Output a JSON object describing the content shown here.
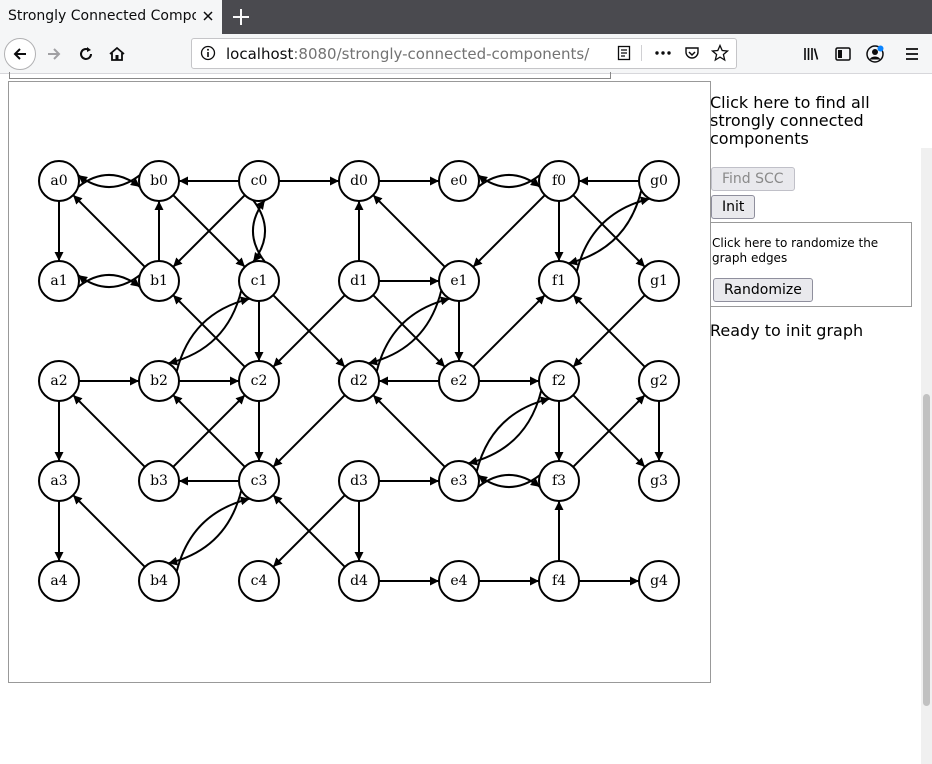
{
  "browser": {
    "tab_title": "Strongly Connected Components",
    "url_host": "localhost",
    "url_path": ":8080/strongly-connected-components/",
    "icons": [
      "back-arrow-icon",
      "forward-arrow-icon",
      "reload-icon",
      "home-icon",
      "info-icon",
      "reader-view-icon",
      "more-icon",
      "pocket-icon",
      "bookmark-star-icon",
      "library-icon",
      "sidebar-icon",
      "account-icon",
      "menu-icon"
    ]
  },
  "panel": {
    "find_description": "Click here to find all strongly connected components",
    "find_button": "Find SCC",
    "init_button": "Init",
    "randomize_description": "Click here to randomize the graph edges",
    "randomize_button": "Randomize",
    "status": "Ready to init graph"
  },
  "graph": {
    "nodes": [
      "a0",
      "b0",
      "c0",
      "d0",
      "e0",
      "f0",
      "g0",
      "a1",
      "b1",
      "c1",
      "d1",
      "e1",
      "f1",
      "g1",
      "a2",
      "b2",
      "c2",
      "d2",
      "e2",
      "f2",
      "g2",
      "a3",
      "b3",
      "c3",
      "d3",
      "e3",
      "f3",
      "g3",
      "a4",
      "b4",
      "c4",
      "d4",
      "e4",
      "f4",
      "g4"
    ],
    "edges": [
      [
        "a0",
        "a1"
      ],
      [
        "a0",
        "b0"
      ],
      [
        "b0",
        "a0"
      ],
      [
        "a1",
        "b1"
      ],
      [
        "b1",
        "a1"
      ],
      [
        "b1",
        "a0"
      ],
      [
        "b1",
        "b0"
      ],
      [
        "b0",
        "c1"
      ],
      [
        "c0",
        "b0"
      ],
      [
        "c0",
        "b1"
      ],
      [
        "c0",
        "c1"
      ],
      [
        "c1",
        "c0"
      ],
      [
        "c0",
        "d0"
      ],
      [
        "c1",
        "c2"
      ],
      [
        "c1",
        "d2"
      ],
      [
        "c2",
        "b1"
      ],
      [
        "b2",
        "c2"
      ],
      [
        "b2",
        "c1"
      ],
      [
        "c1",
        "b2"
      ],
      [
        "c2",
        "c3"
      ],
      [
        "c3",
        "b2"
      ],
      [
        "b3",
        "c2"
      ],
      [
        "b3",
        "a2"
      ],
      [
        "a2",
        "b2"
      ],
      [
        "a2",
        "a3"
      ],
      [
        "c3",
        "b3"
      ],
      [
        "a3",
        "a4"
      ],
      [
        "b4",
        "a3"
      ],
      [
        "b4",
        "c3"
      ],
      [
        "c3",
        "b4"
      ],
      [
        "d1",
        "d0"
      ],
      [
        "d1",
        "c2"
      ],
      [
        "d1",
        "e1"
      ],
      [
        "d1",
        "e2"
      ],
      [
        "e1",
        "d0"
      ],
      [
        "d0",
        "e0"
      ],
      [
        "d2",
        "c3"
      ],
      [
        "d2",
        "e1"
      ],
      [
        "e1",
        "d2"
      ],
      [
        "e1",
        "e2"
      ],
      [
        "e2",
        "d2"
      ],
      [
        "e2",
        "f2"
      ],
      [
        "d3",
        "c4"
      ],
      [
        "d3",
        "e3"
      ],
      [
        "d3",
        "d4"
      ],
      [
        "d4",
        "c3"
      ],
      [
        "d4",
        "e4"
      ],
      [
        "e0",
        "f0"
      ],
      [
        "f0",
        "e0"
      ],
      [
        "f0",
        "e1"
      ],
      [
        "f0",
        "f1"
      ],
      [
        "f0",
        "g1"
      ],
      [
        "g0",
        "f0"
      ],
      [
        "g0",
        "f1"
      ],
      [
        "f1",
        "g0"
      ],
      [
        "e2",
        "f1"
      ],
      [
        "e3",
        "d2"
      ],
      [
        "e3",
        "f2"
      ],
      [
        "f2",
        "e3"
      ],
      [
        "e3",
        "f3"
      ],
      [
        "f3",
        "e3"
      ],
      [
        "f2",
        "f3"
      ],
      [
        "f2",
        "g3"
      ],
      [
        "g1",
        "f2"
      ],
      [
        "g2",
        "f1"
      ],
      [
        "g2",
        "g3"
      ],
      [
        "f3",
        "g2"
      ],
      [
        "f4",
        "f3"
      ],
      [
        "e4",
        "f4"
      ],
      [
        "f4",
        "g4"
      ]
    ]
  }
}
